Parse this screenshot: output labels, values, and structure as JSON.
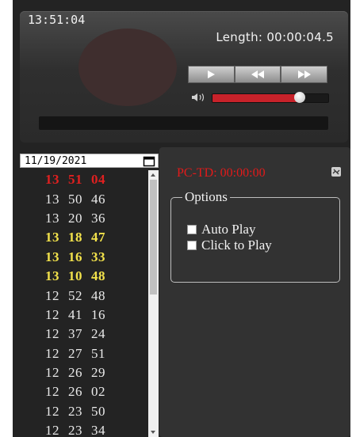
{
  "player": {
    "clock": "13:51:04",
    "length_text": "Length: 00:00:04.5",
    "volume_level": 0.76,
    "buttons": [
      {
        "name": "play-button",
        "icon": "play-icon"
      },
      {
        "name": "rewind-button",
        "icon": "rewind-icon"
      },
      {
        "name": "fast-forward-button",
        "icon": "fast-forward-icon"
      }
    ]
  },
  "date_picker": {
    "value": "11/19/2021",
    "icon": "calendar-icon"
  },
  "calls": [
    {
      "h": "13",
      "m": "51",
      "s": "04",
      "status": "red"
    },
    {
      "h": "13",
      "m": "50",
      "s": "46",
      "status": "normal"
    },
    {
      "h": "13",
      "m": "20",
      "s": "36",
      "status": "normal"
    },
    {
      "h": "13",
      "m": "18",
      "s": "47",
      "status": "yellow"
    },
    {
      "h": "13",
      "m": "16",
      "s": "33",
      "status": "yellow"
    },
    {
      "h": "13",
      "m": "10",
      "s": "48",
      "status": "yellow"
    },
    {
      "h": "12",
      "m": "52",
      "s": "48",
      "status": "normal"
    },
    {
      "h": "12",
      "m": "41",
      "s": "16",
      "status": "normal"
    },
    {
      "h": "12",
      "m": "37",
      "s": "24",
      "status": "normal"
    },
    {
      "h": "12",
      "m": "27",
      "s": "51",
      "status": "normal"
    },
    {
      "h": "12",
      "m": "26",
      "s": "29",
      "status": "normal"
    },
    {
      "h": "12",
      "m": "26",
      "s": "02",
      "status": "normal"
    },
    {
      "h": "12",
      "m": "23",
      "s": "50",
      "status": "normal"
    },
    {
      "h": "12",
      "m": "23",
      "s": "34",
      "status": "normal"
    }
  ],
  "details": {
    "pctd": "PC-TD: 00:00:00",
    "options_title": "Options",
    "options": [
      {
        "label": "Auto Play",
        "checked": false
      },
      {
        "label": "Click to Play",
        "checked": false
      }
    ]
  },
  "colors": {
    "red": "#e02020",
    "yellow": "#f2e24b",
    "volume": "#c8222a"
  }
}
